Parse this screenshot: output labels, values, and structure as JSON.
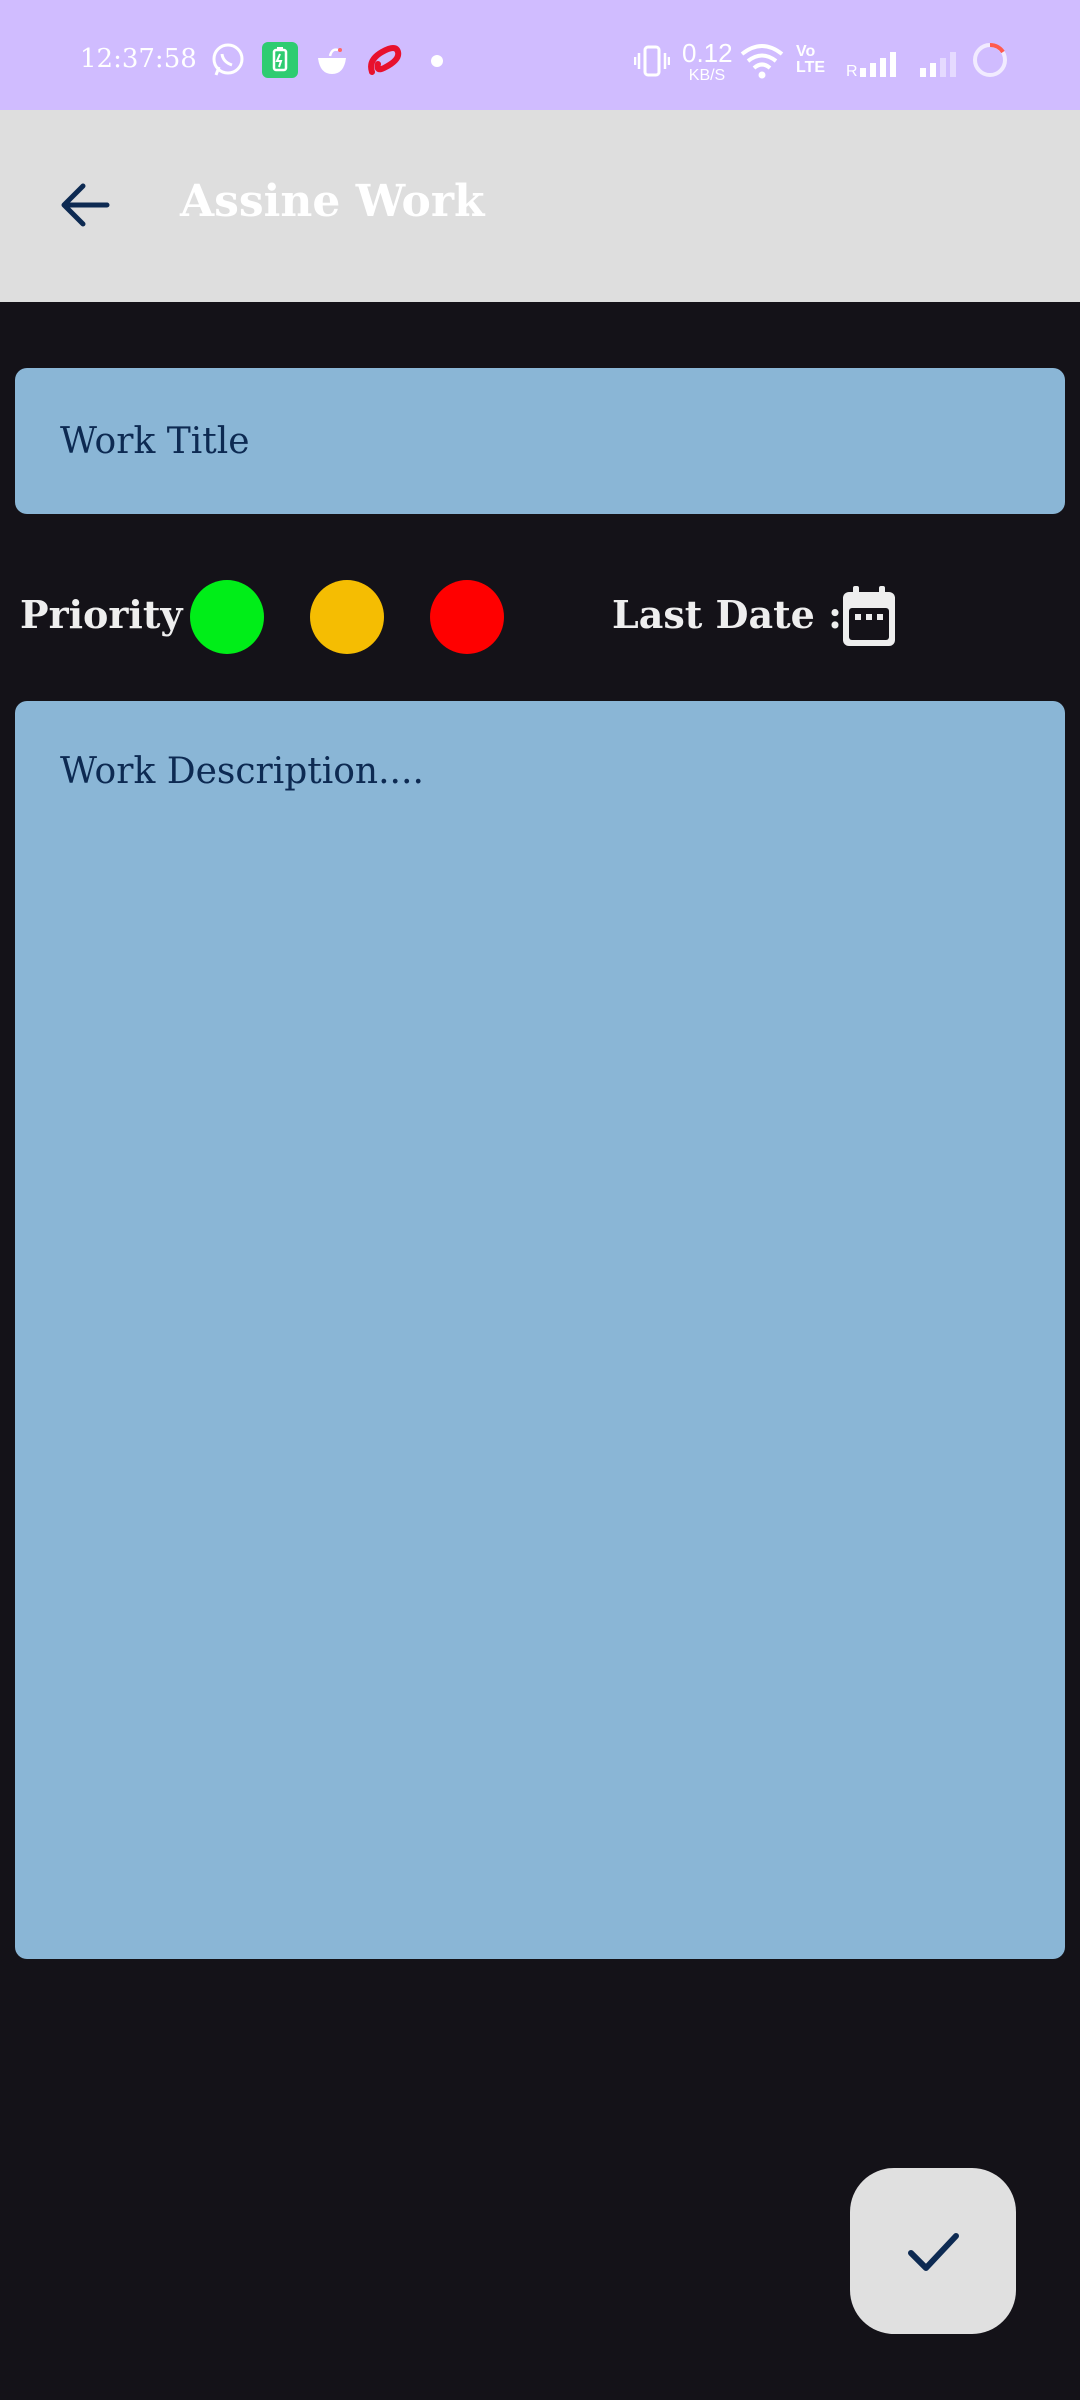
{
  "status_bar": {
    "time": "12:37:58",
    "net_speed_value": "0.12",
    "net_speed_unit": "KB/S",
    "volte": "Vo LTE",
    "icons": [
      "whatsapp-icon",
      "battery-saver-icon",
      "swiggy-icon",
      "airtel-icon",
      "dot-icon",
      "vibrate-icon",
      "wifi-icon",
      "signal-icon",
      "loading-icon"
    ]
  },
  "app_bar": {
    "title": "Assine Work",
    "back_icon": "arrow-back-icon"
  },
  "form": {
    "title_placeholder": "Work Title",
    "priority_label": "Priority :",
    "priority_colors": [
      "#00ee18",
      "#f5bd02",
      "#ff0000"
    ],
    "last_date_label": "Last Date :",
    "calendar_icon": "calendar-icon",
    "description_placeholder": "Work Description...."
  },
  "fab": {
    "icon": "check-icon"
  },
  "colors": {
    "status_bar_bg": "#d0bcff",
    "app_bar_bg": "#dedede",
    "page_bg": "#141218",
    "field_bg": "#8ab6d6",
    "field_text": "#0d2a52"
  }
}
